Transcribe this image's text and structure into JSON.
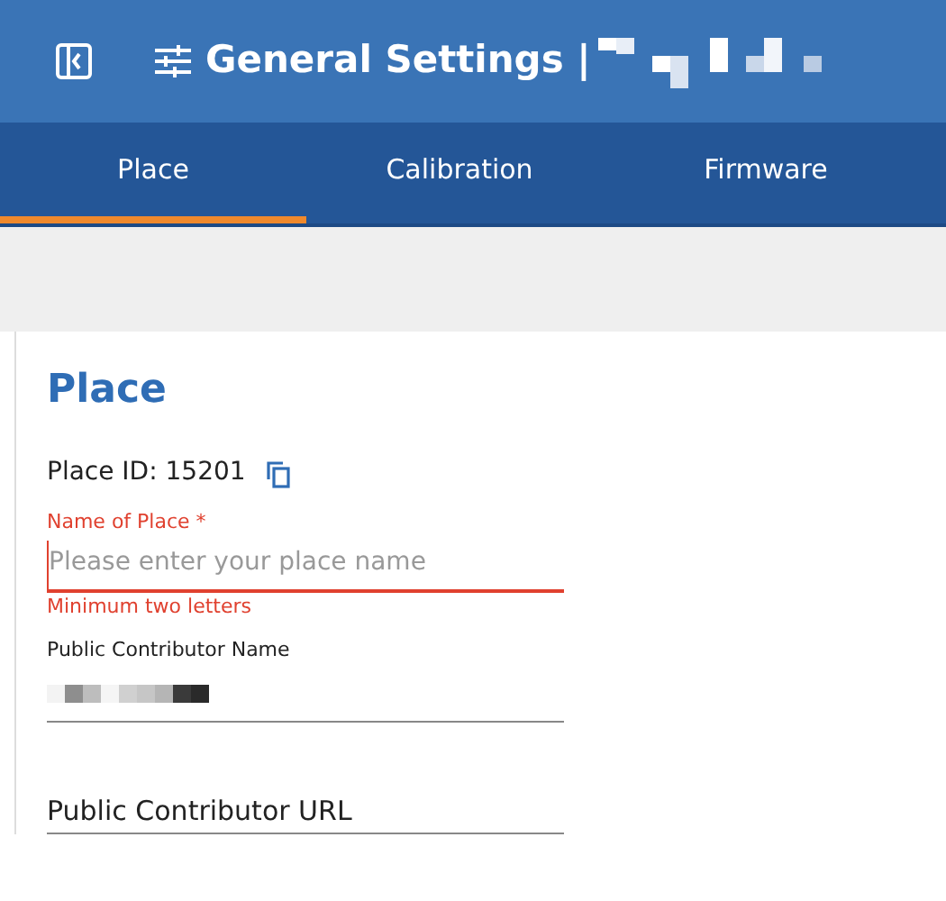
{
  "header": {
    "title": "General Settings |"
  },
  "tabs": [
    {
      "label": "Place",
      "selected": true
    },
    {
      "label": "Calibration",
      "selected": false
    },
    {
      "label": "Firmware",
      "selected": false
    }
  ],
  "section": {
    "heading": "Place",
    "place_id": "Place ID: 15201"
  },
  "fields": [
    {
      "kind": "text",
      "label": "Name of Place *",
      "placeholder": "Please enter your place name",
      "error": "Minimum two letters",
      "invalid": true
    },
    {
      "kind": "redacted",
      "label": "Public Contributor Name"
    },
    {
      "kind": "floating",
      "label": "Public Contributor URL"
    }
  ]
}
